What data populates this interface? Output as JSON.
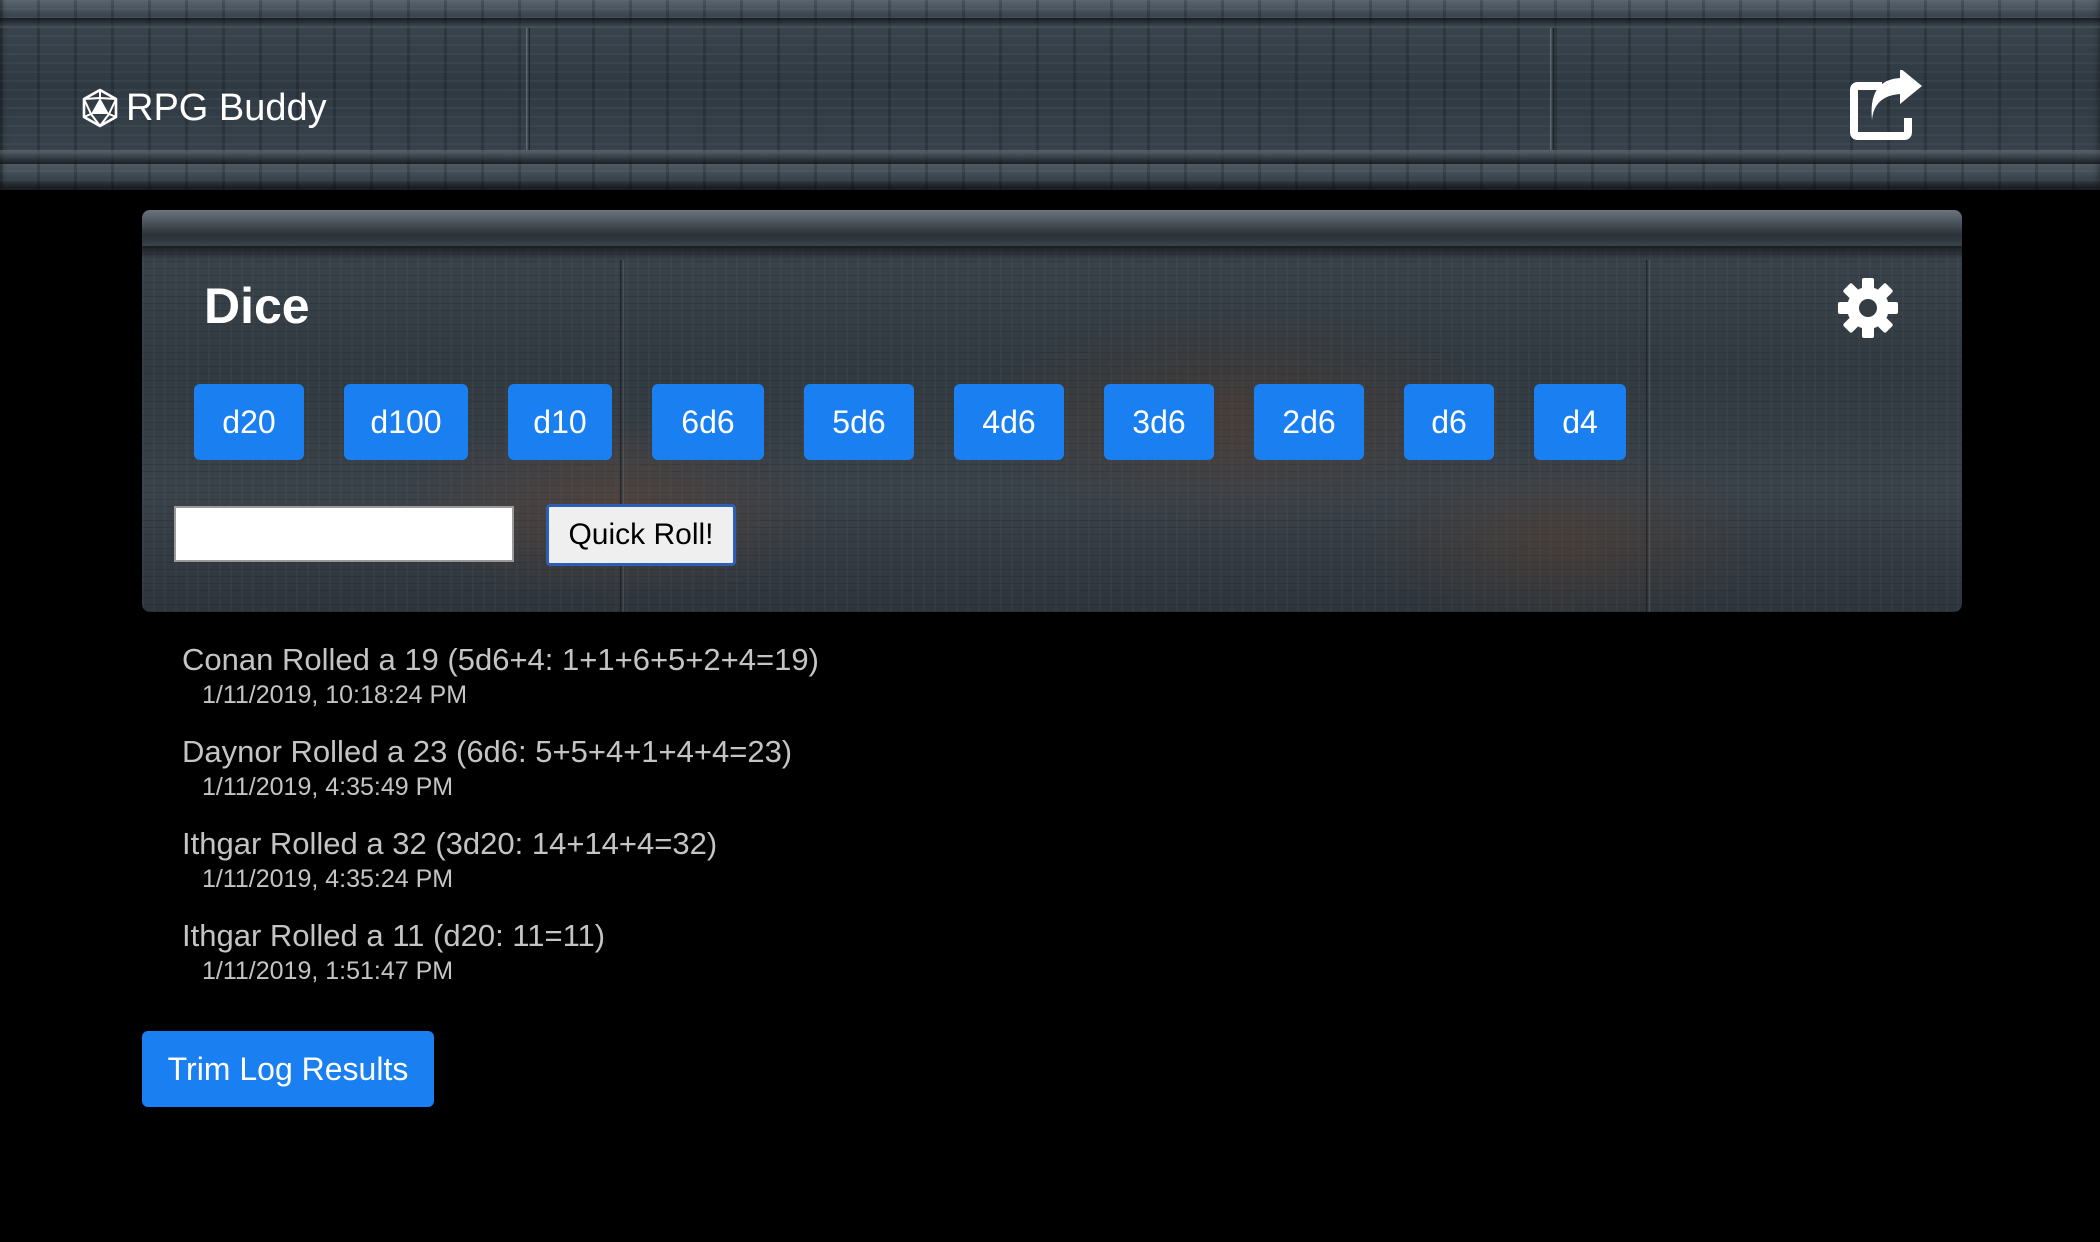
{
  "header": {
    "brand_name": "RPG Buddy",
    "brand_icon": "d20-icon",
    "share_icon": "share-icon"
  },
  "dice_panel": {
    "title": "Dice",
    "settings_icon": "gear-icon",
    "buttons": [
      "d20",
      "d100",
      "d10",
      "6d6",
      "5d6",
      "4d6",
      "3d6",
      "2d6",
      "d6",
      "d4"
    ],
    "quick_roll": {
      "value": "",
      "placeholder": "",
      "button_label": "Quick Roll!"
    }
  },
  "log": [
    {
      "text": "Conan Rolled a 19 (5d6+4: 1+1+6+5+2+4=19)",
      "time": "1/11/2019, 10:18:24 PM"
    },
    {
      "text": "Daynor Rolled a 23 (6d6: 5+5+4+1+4+4=23)",
      "time": "1/11/2019, 4:35:49 PM"
    },
    {
      "text": "Ithgar Rolled a 32 (3d20: 14+14+4=32)",
      "time": "1/11/2019, 4:35:24 PM"
    },
    {
      "text": "Ithgar Rolled a 11 (d20: 11=11)",
      "time": "1/11/2019, 1:51:47 PM"
    }
  ],
  "trim_button_label": "Trim Log Results",
  "colors": {
    "primary_button": "#1a7ff0",
    "page_background": "#000000",
    "log_text": "#c4c4c4"
  }
}
